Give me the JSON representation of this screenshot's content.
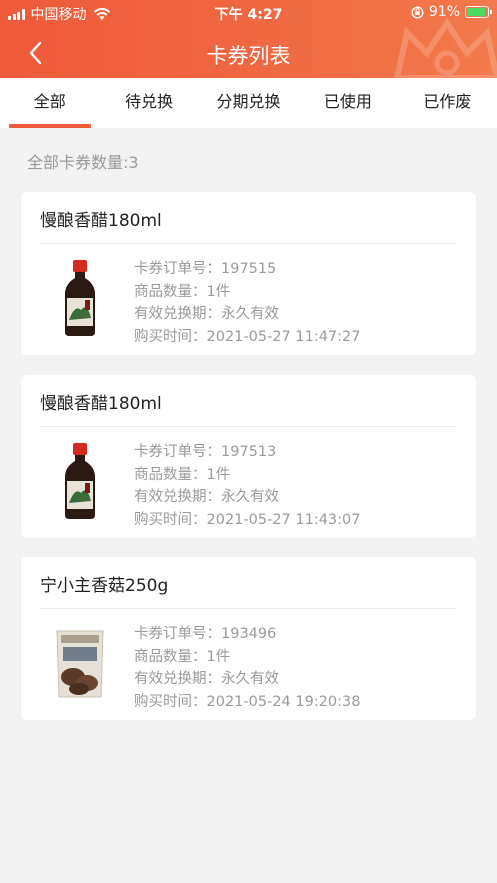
{
  "status_bar": {
    "carrier": "中国移动",
    "time": "下午 4:27",
    "battery": "91%",
    "battery_fraction": 0.91
  },
  "nav": {
    "title": "卡券列表",
    "back_icon": "chevron-left-icon"
  },
  "tabs": [
    {
      "label": "全部",
      "active": true
    },
    {
      "label": "待兑换",
      "active": false
    },
    {
      "label": "分期兑换",
      "active": false
    },
    {
      "label": "已使用",
      "active": false
    },
    {
      "label": "已作废",
      "active": false
    }
  ],
  "summary": {
    "count_text": "全部卡券数量:3"
  },
  "coupons": [
    {
      "title": "慢酿香醋180ml",
      "image": "vinegar-bottle",
      "order_no": "卡券订单号：197515",
      "quantity": "商品数量：1件",
      "validity": "有效兑换期：永久有效",
      "purchase_time": "购买时间：2021-05-27 11:47:27"
    },
    {
      "title": "慢酿香醋180ml",
      "image": "vinegar-bottle",
      "order_no": "卡券订单号：197513",
      "quantity": "商品数量：1件",
      "validity": "有效兑换期：永久有效",
      "purchase_time": "购买时间：2021-05-27 11:43:07"
    },
    {
      "title": "宁小主香菇250g",
      "image": "mushroom-bag",
      "order_no": "卡券订单号：193496",
      "quantity": "商品数量：1件",
      "validity": "有效兑换期：永久有效",
      "purchase_time": "购买时间：2021-05-24 19:20:38"
    }
  ],
  "colors": {
    "accent": "#ee5a3a",
    "background": "#f2f2f2",
    "muted_text": "#9a9a9a"
  }
}
